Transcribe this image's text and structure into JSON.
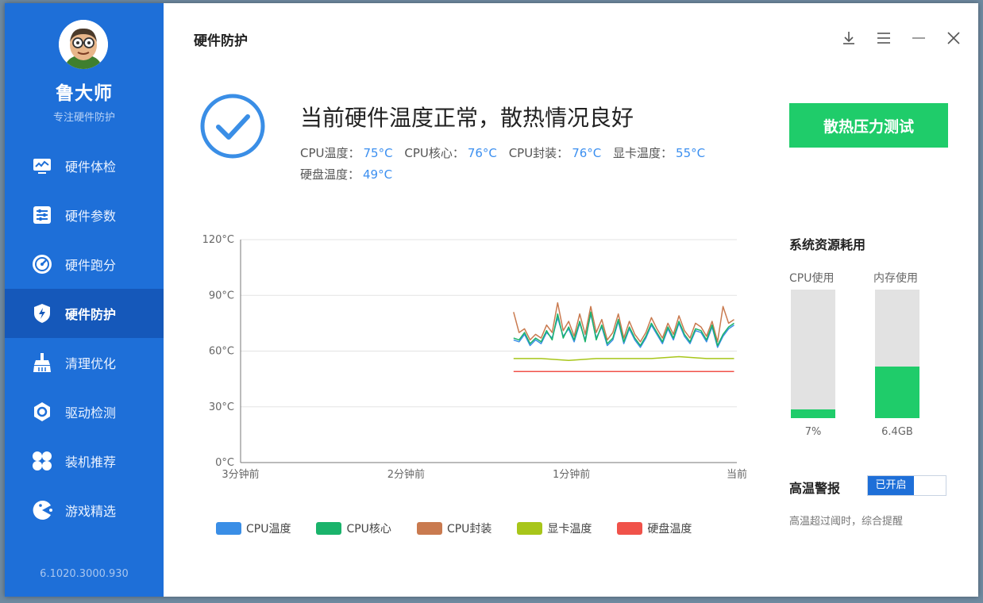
{
  "app": {
    "name": "鲁大师",
    "tagline": "专注硬件防护",
    "version": "6.1020.3000.930"
  },
  "sidebar": {
    "items": [
      {
        "label": "硬件体检",
        "icon": "monitor-icon"
      },
      {
        "label": "硬件参数",
        "icon": "sliders-icon"
      },
      {
        "label": "硬件跑分",
        "icon": "speedometer-icon"
      },
      {
        "label": "硬件防护",
        "icon": "shield-icon",
        "active": true
      },
      {
        "label": "清理优化",
        "icon": "broom-icon"
      },
      {
        "label": "驱动检测",
        "icon": "gear-icon"
      },
      {
        "label": "装机推荐",
        "icon": "grid-icon"
      },
      {
        "label": "游戏精选",
        "icon": "pacman-icon"
      }
    ]
  },
  "header": {
    "title": "硬件防护",
    "buttons": [
      "download-icon",
      "menu-icon",
      "minimize-icon",
      "close-icon"
    ]
  },
  "status": {
    "headline": "当前硬件温度正常，散热情况良好",
    "temps": [
      {
        "label": "CPU温度：",
        "value": "75°C"
      },
      {
        "label": "CPU核心：",
        "value": "76°C"
      },
      {
        "label": "CPU封装：",
        "value": "76°C"
      },
      {
        "label": "显卡温度：",
        "value": "55°C"
      },
      {
        "label": "硬盘温度：",
        "value": "49°C"
      }
    ],
    "stress_button": "散热压力测试"
  },
  "chart_data": {
    "type": "line",
    "y_ticks": [
      "120°C",
      "90°C",
      "60°C",
      "30°C",
      "0°C"
    ],
    "ylim": [
      0,
      120
    ],
    "x_ticks": [
      "3分钟前",
      "2分钟前",
      "1分钟前",
      "当前"
    ],
    "xlim": [
      -180,
      0
    ],
    "grid": true,
    "legend_position": "bottom",
    "series": [
      {
        "name": "CPU温度",
        "color": "#3a8ee6",
        "x": [
          -81,
          -79,
          -77,
          -75,
          -73,
          -71,
          -69,
          -67,
          -65,
          -63,
          -61,
          -59,
          -57,
          -55,
          -53,
          -51,
          -49,
          -47,
          -45,
          -43,
          -41,
          -39,
          -37,
          -35,
          -33,
          -31,
          -29,
          -27,
          -25,
          -23,
          -21,
          -19,
          -17,
          -15,
          -13,
          -11,
          -9,
          -7,
          -5,
          -3,
          -1
        ],
        "y": [
          66,
          65,
          69,
          63,
          66,
          64,
          70,
          67,
          78,
          68,
          72,
          65,
          75,
          66,
          80,
          67,
          73,
          63,
          66,
          76,
          64,
          72,
          66,
          62,
          67,
          74,
          69,
          64,
          72,
          66,
          75,
          68,
          64,
          71,
          70,
          65,
          73,
          62,
          68,
          72,
          74
        ]
      },
      {
        "name": "CPU核心",
        "color": "#1ab36b",
        "x": [
          -81,
          -79,
          -77,
          -75,
          -73,
          -71,
          -69,
          -67,
          -65,
          -63,
          -61,
          -59,
          -57,
          -55,
          -53,
          -51,
          -49,
          -47,
          -45,
          -43,
          -41,
          -39,
          -37,
          -35,
          -33,
          -31,
          -29,
          -27,
          -25,
          -23,
          -21,
          -19,
          -17,
          -15,
          -13,
          -11,
          -9,
          -7,
          -5,
          -3,
          -1
        ],
        "y": [
          67,
          66,
          70,
          64,
          67,
          65,
          71,
          66,
          80,
          67,
          73,
          66,
          76,
          65,
          81,
          66,
          74,
          64,
          67,
          77,
          65,
          73,
          67,
          63,
          68,
          75,
          70,
          65,
          73,
          67,
          76,
          69,
          65,
          72,
          71,
          66,
          74,
          63,
          69,
          73,
          75
        ]
      },
      {
        "name": "CPU封装",
        "color": "#c97a4f",
        "x": [
          -81,
          -79,
          -77,
          -75,
          -73,
          -71,
          -69,
          -67,
          -65,
          -63,
          -61,
          -59,
          -57,
          -55,
          -53,
          -51,
          -49,
          -47,
          -45,
          -43,
          -41,
          -39,
          -37,
          -35,
          -33,
          -31,
          -29,
          -27,
          -25,
          -23,
          -21,
          -19,
          -17,
          -15,
          -13,
          -11,
          -9,
          -7,
          -5,
          -3,
          -1
        ],
        "y": [
          81,
          70,
          72,
          66,
          69,
          67,
          74,
          70,
          86,
          71,
          76,
          68,
          80,
          69,
          84,
          70,
          77,
          66,
          70,
          80,
          67,
          76,
          69,
          65,
          70,
          78,
          72,
          67,
          75,
          69,
          79,
          71,
          67,
          75,
          73,
          68,
          76,
          65,
          84,
          75,
          77
        ]
      },
      {
        "name": "显卡温度",
        "color": "#a8c61a",
        "x": [
          -81,
          -71,
          -61,
          -51,
          -41,
          -31,
          -21,
          -11,
          -1
        ],
        "y": [
          56,
          56,
          55,
          56,
          56,
          56,
          57,
          56,
          56
        ]
      },
      {
        "name": "硬盘温度",
        "color": "#f0524a",
        "x": [
          -81,
          -71,
          -61,
          -51,
          -41,
          -31,
          -21,
          -11,
          -1
        ],
        "y": [
          49,
          49,
          49,
          49,
          49,
          49,
          49,
          49,
          49
        ]
      }
    ]
  },
  "resources": {
    "title": "系统资源耗用",
    "cpu": {
      "label": "CPU使用",
      "value": "7%",
      "fraction": 0.07
    },
    "mem": {
      "label": "内存使用",
      "value": "6.4GB",
      "fraction": 0.4
    }
  },
  "alarm": {
    "label": "高温警报",
    "toggle_text": "已开启",
    "description": "高温超过阈时，综合提醒"
  }
}
